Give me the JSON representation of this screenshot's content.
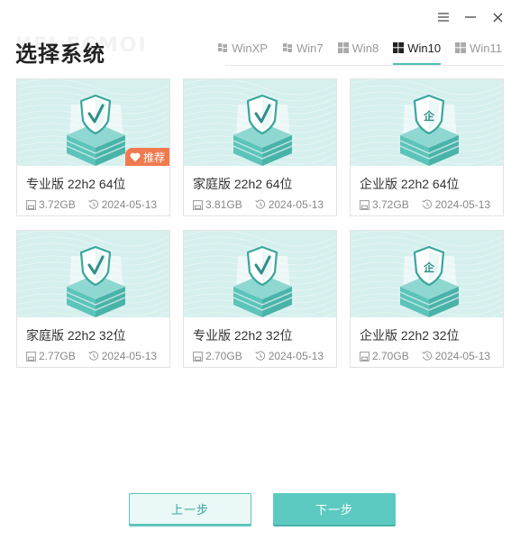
{
  "window": {
    "controls": [
      {
        "name": "menu-icon"
      },
      {
        "name": "minimize-icon"
      },
      {
        "name": "close-icon"
      }
    ]
  },
  "header": {
    "title": "选择系统",
    "watermark": "UEI FCMOI"
  },
  "tabs": [
    {
      "label": "WinXP",
      "icon": "windows-xp-icon",
      "active": false
    },
    {
      "label": "Win7",
      "icon": "windows-7-icon",
      "active": false
    },
    {
      "label": "Win8",
      "icon": "windows-8-icon",
      "active": false
    },
    {
      "label": "Win10",
      "icon": "windows-10-icon",
      "active": true
    },
    {
      "label": "Win11",
      "icon": "windows-11-icon",
      "active": false
    }
  ],
  "cards": [
    {
      "title": "专业版 22h2 64位",
      "size": "3.72GB",
      "date": "2024-05-13",
      "emblem": "check",
      "badge": "推荐"
    },
    {
      "title": "家庭版 22h2 64位",
      "size": "3.81GB",
      "date": "2024-05-13",
      "emblem": "check"
    },
    {
      "title": "企业版 22h2 64位",
      "size": "3.72GB",
      "date": "2024-05-13",
      "emblem": "企"
    },
    {
      "title": "家庭版 22h2 32位",
      "size": "2.77GB",
      "date": "2024-05-13",
      "emblem": "check"
    },
    {
      "title": "专业版 22h2 32位",
      "size": "2.70GB",
      "date": "2024-05-13",
      "emblem": "check"
    },
    {
      "title": "企业版 22h2 32位",
      "size": "2.70GB",
      "date": "2024-05-13",
      "emblem": "企"
    }
  ],
  "footer": {
    "prev_label": "上一步",
    "next_label": "下一步"
  },
  "colors": {
    "accent": "#5ccac0",
    "card_bg": "#d6f0ee",
    "badge": "#f07a4f"
  }
}
